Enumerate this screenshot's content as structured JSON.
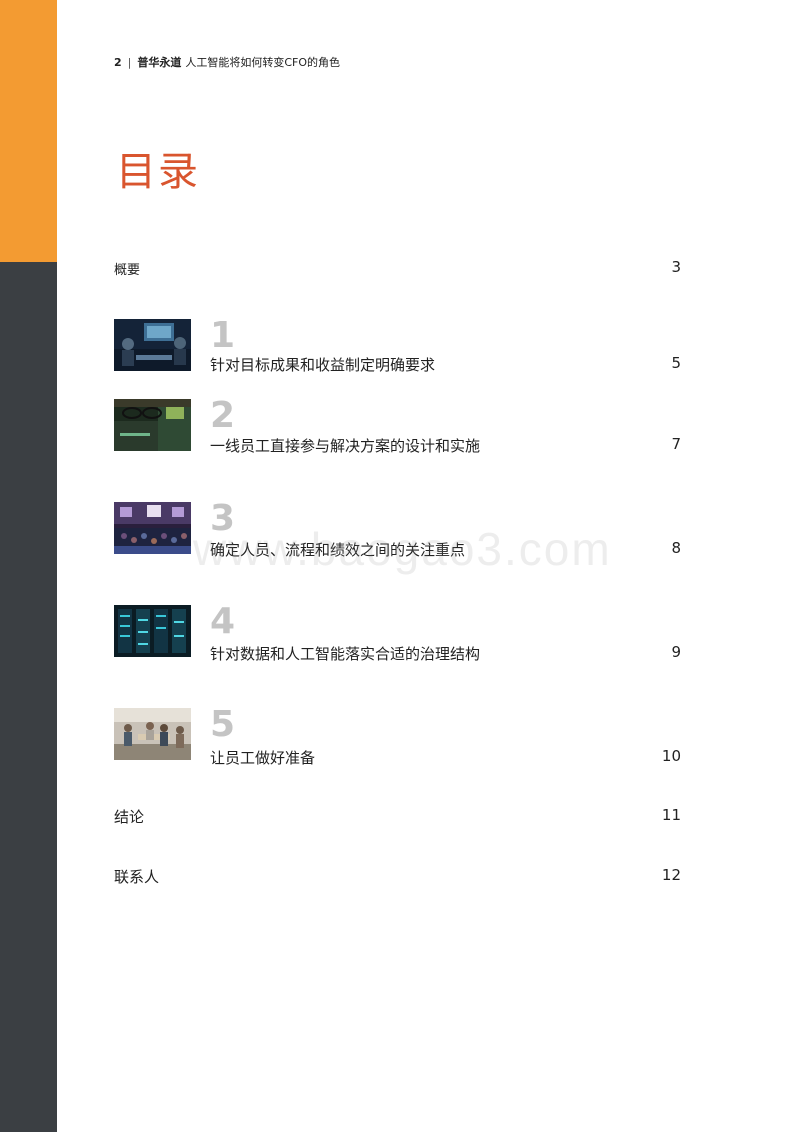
{
  "header": {
    "page": "2",
    "separator": "|",
    "brand": "普华永道",
    "subtitle": "人工智能将如何转变CFO的角色"
  },
  "title": "目录",
  "toc": {
    "summary": {
      "label": "概要",
      "page": "3"
    },
    "chapters": [
      {
        "num": "1",
        "label": "针对目标成果和收益制定明确要求",
        "page": "5",
        "image": "meeting-room-photo"
      },
      {
        "num": "2",
        "label": "一线员工直接参与解决方案的设计和实施",
        "page": "7",
        "image": "glasses-screen-photo"
      },
      {
        "num": "3",
        "label": "确定人员、流程和绩效之间的关注重点",
        "page": "8",
        "image": "conference-audience-photo"
      },
      {
        "num": "4",
        "label": "针对数据和人工智能落实合适的治理结构",
        "page": "9",
        "image": "server-racks-photo"
      },
      {
        "num": "5",
        "label": "让员工做好准备",
        "page": "10",
        "image": "office-team-photo"
      }
    ],
    "conclusion": {
      "label": "结论",
      "page": "11"
    },
    "contacts": {
      "label": "联系人",
      "page": "12"
    }
  },
  "watermark": "www.baogao3.com",
  "colors": {
    "accent_orange": "#f39b32",
    "sidebar_dark": "#3b3f43",
    "title_red": "#d9552e",
    "chapter_gray": "#c4c4c4"
  }
}
